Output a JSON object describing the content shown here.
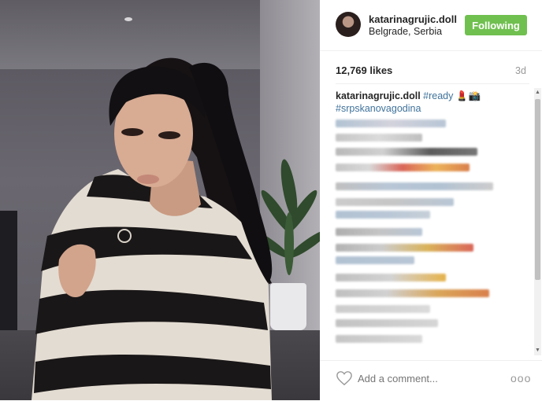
{
  "photo": {
    "alt_name": "post-photo"
  },
  "header": {
    "username": "katarinagrujic.doll",
    "location": "Belgrade, Serbia",
    "follow_label": "Following"
  },
  "stats": {
    "likes": "12,769 likes",
    "age": "3d"
  },
  "caption": {
    "username": "katarinagrujic.doll",
    "hashtag_1": "#ready",
    "emoji_1": "💄📸",
    "hashtag_2": "#srpskanovagodina"
  },
  "comment": {
    "placeholder": "Add a comment...",
    "more_label": "ooo"
  },
  "colors": {
    "follow_bg": "#70c050",
    "hashtag": "#3f729b",
    "text": "#262626",
    "muted": "#999999"
  }
}
